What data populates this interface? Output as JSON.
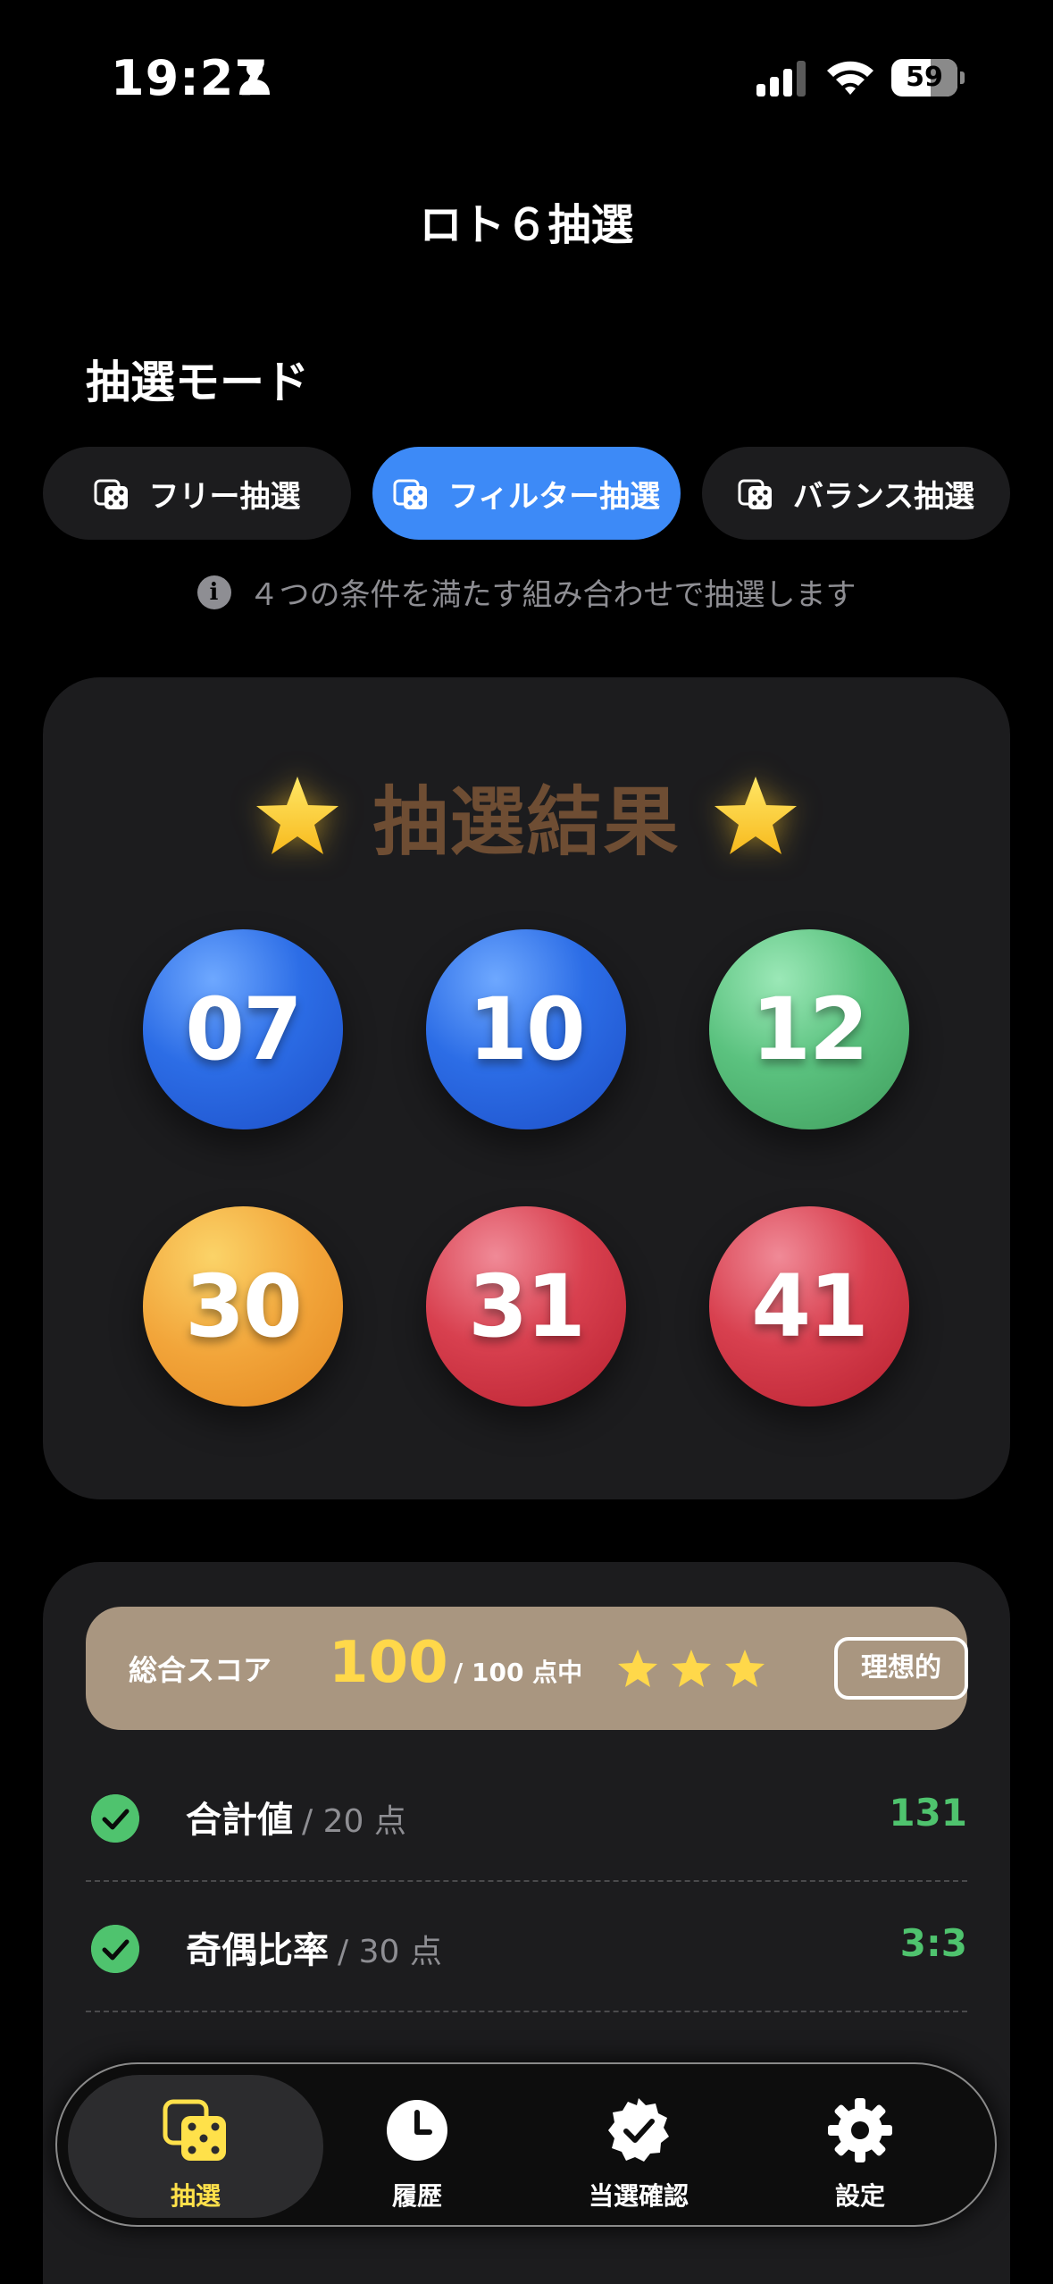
{
  "status": {
    "time": "19:27",
    "battery": "59",
    "battery_fraction": 0.59
  },
  "nav": {
    "title": "ロト６抽選"
  },
  "mode": {
    "title": "抽選モード",
    "options": [
      {
        "label": "フリー抽選",
        "active": false
      },
      {
        "label": "フィルター抽選",
        "active": true
      },
      {
        "label": "バランス抽選",
        "active": false
      }
    ],
    "note": "４つの条件を満たす組み合わせで抽選します"
  },
  "result": {
    "title": "抽選結果",
    "balls": [
      {
        "number": "07",
        "color": "#2c6de6"
      },
      {
        "number": "10",
        "color": "#2c6de6"
      },
      {
        "number": "12",
        "color": "#5bc27f"
      },
      {
        "number": "30",
        "color": "#f2a53a"
      },
      {
        "number": "31",
        "color": "#d8404f"
      },
      {
        "number": "41",
        "color": "#d8404f"
      }
    ]
  },
  "score": {
    "label": "総合スコア",
    "value": "100",
    "max_text": "/ 100 点中",
    "stars": 3,
    "badge": "理想的",
    "criteria": [
      {
        "name": "合計値",
        "points": "/ 20 点",
        "value": "131"
      },
      {
        "name": "奇偶比率",
        "points": "/ 30 点",
        "value": "3:3"
      }
    ]
  },
  "tabs": [
    {
      "label": "抽選",
      "active": true
    },
    {
      "label": "履歴",
      "active": false
    },
    {
      "label": "当選確認",
      "active": false
    },
    {
      "label": "設定",
      "active": false
    }
  ],
  "colors": {
    "accent": "#3d8af7",
    "success": "#4fc36e",
    "highlight": "#ffd84a",
    "tab_active": "#ffe14a"
  }
}
